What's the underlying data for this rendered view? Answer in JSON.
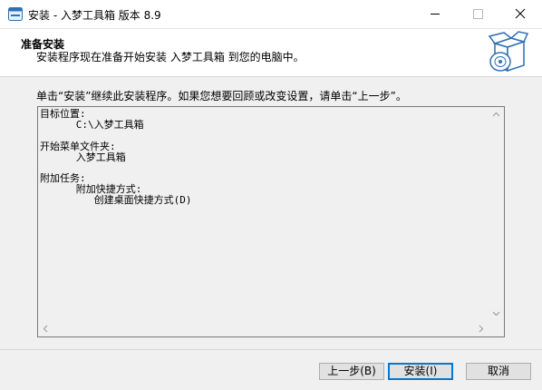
{
  "window": {
    "title": "安装 - 入梦工具箱 版本 8.9",
    "icon": "installer-app-icon",
    "controls": [
      "minimize-icon",
      "maximize-icon",
      "close-icon"
    ]
  },
  "header": {
    "title": "准备安装",
    "subtitle": "安装程序现在准备开始安装 入梦工具箱 到您的电脑中。",
    "image": "setup-box-disc-icon"
  },
  "instruction": "单击“安装”继续此安装程序。如果您想要回顾或改变设置，请单击“上一步”。",
  "memo": {
    "text": "目标位置:\n      C:\\入梦工具箱\n\n开始菜单文件夹:\n      入梦工具箱\n\n附加任务:\n      附加快捷方式:\n         创建桌面快捷方式(D)"
  },
  "buttons": {
    "back": "上一步(B)",
    "install": "安装(I)",
    "cancel": "取消"
  },
  "colors": {
    "window_bg": "#f0f0f0",
    "header_bg": "#ffffff",
    "default_button_border": "#0078d7",
    "button_bg": "#e1e1e1",
    "icon_blue": "#2f6fb3"
  }
}
